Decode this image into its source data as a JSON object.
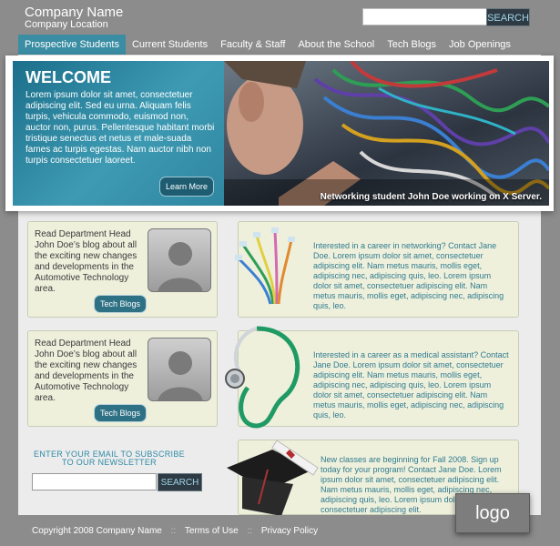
{
  "header": {
    "company_name": "Company Name",
    "company_location": "Company Location",
    "search_button": "SEARCH",
    "search_placeholder": ""
  },
  "nav": {
    "items": [
      "Prospective Students",
      "Current Students",
      "Faculty & Staff",
      "About the School",
      "Tech Blogs",
      "Job Openings"
    ],
    "active_index": 0
  },
  "hero": {
    "title": "WELCOME",
    "body": "Lorem ipsum dolor sit amet, consectetuer adipiscing elit. Sed eu urna. Aliquam felis turpis, vehicula commodo, euismod non, auctor non, purus. Pellentesque habitant morbi tristique senectus et netus et male-suada fames ac turpis egestas. Nam auctor nibh non turpis consectetuer laoreet.",
    "button": "Learn More",
    "caption": "Networking student John Doe working on X Server."
  },
  "blog_cards": [
    {
      "text": "Read Department Head John Doe’s blog about all the exciting new changes and developments in the Automotive Technology area.",
      "button": "Tech Blogs"
    },
    {
      "text": "Read Department Head John Doe’s blog about all the exciting new changes and developments in the Automotive Technology area.",
      "button": "Tech Blogs"
    }
  ],
  "info_cards": [
    {
      "icon": "network-cables-icon",
      "text": "Interested in a career in networking? Contact Jane Doe. Lorem ipsum dolor sit amet, consectetuer adipiscing elit. Nam metus mauris, mollis eget, adipiscing nec, adipiscing quis, leo. Lorem ipsum dolor sit amet, consectetuer adipiscing elit. Nam metus mauris, mollis eget, adipiscing nec, adipiscing quis, leo."
    },
    {
      "icon": "stethoscope-icon",
      "text": "Interested in a career as a medical assistant? Contact Jane Doe. Lorem ipsum dolor sit amet, consectetuer adipiscing elit. Nam metus mauris, mollis eget, adipiscing nec, adipiscing quis, leo. Lorem ipsum dolor sit amet, consectetuer adipiscing elit. Nam metus mauris, mollis eget, adipiscing nec, adipiscing quis, leo."
    },
    {
      "icon": "graduation-cap-icon",
      "text": "New classes are beginning for Fall 2008. Sign up today for your program! Contact Jane Doe. Lorem ipsum dolor sit amet, consectetuer adipiscing elit. Nam metus mauris, mollis eget, adipiscing nec, adipiscing quis, leo. Lorem ipsum dolor sit amet, consectetuer adipiscing elit."
    }
  ],
  "newsletter": {
    "heading": "ENTER YOUR EMAIL TO SUBSCRIBE TO OUR NEWSLETTER",
    "button": "SEARCH",
    "placeholder": ""
  },
  "footer": {
    "copyright": "Copyright 2008 Company Name",
    "separator": "::",
    "terms": "Terms of Use",
    "privacy": "Privacy Policy"
  },
  "logo": "logo",
  "colors": {
    "accent": "#3a8da3",
    "card_background": "#eef0dc",
    "button_dark": "#2f3b44"
  }
}
